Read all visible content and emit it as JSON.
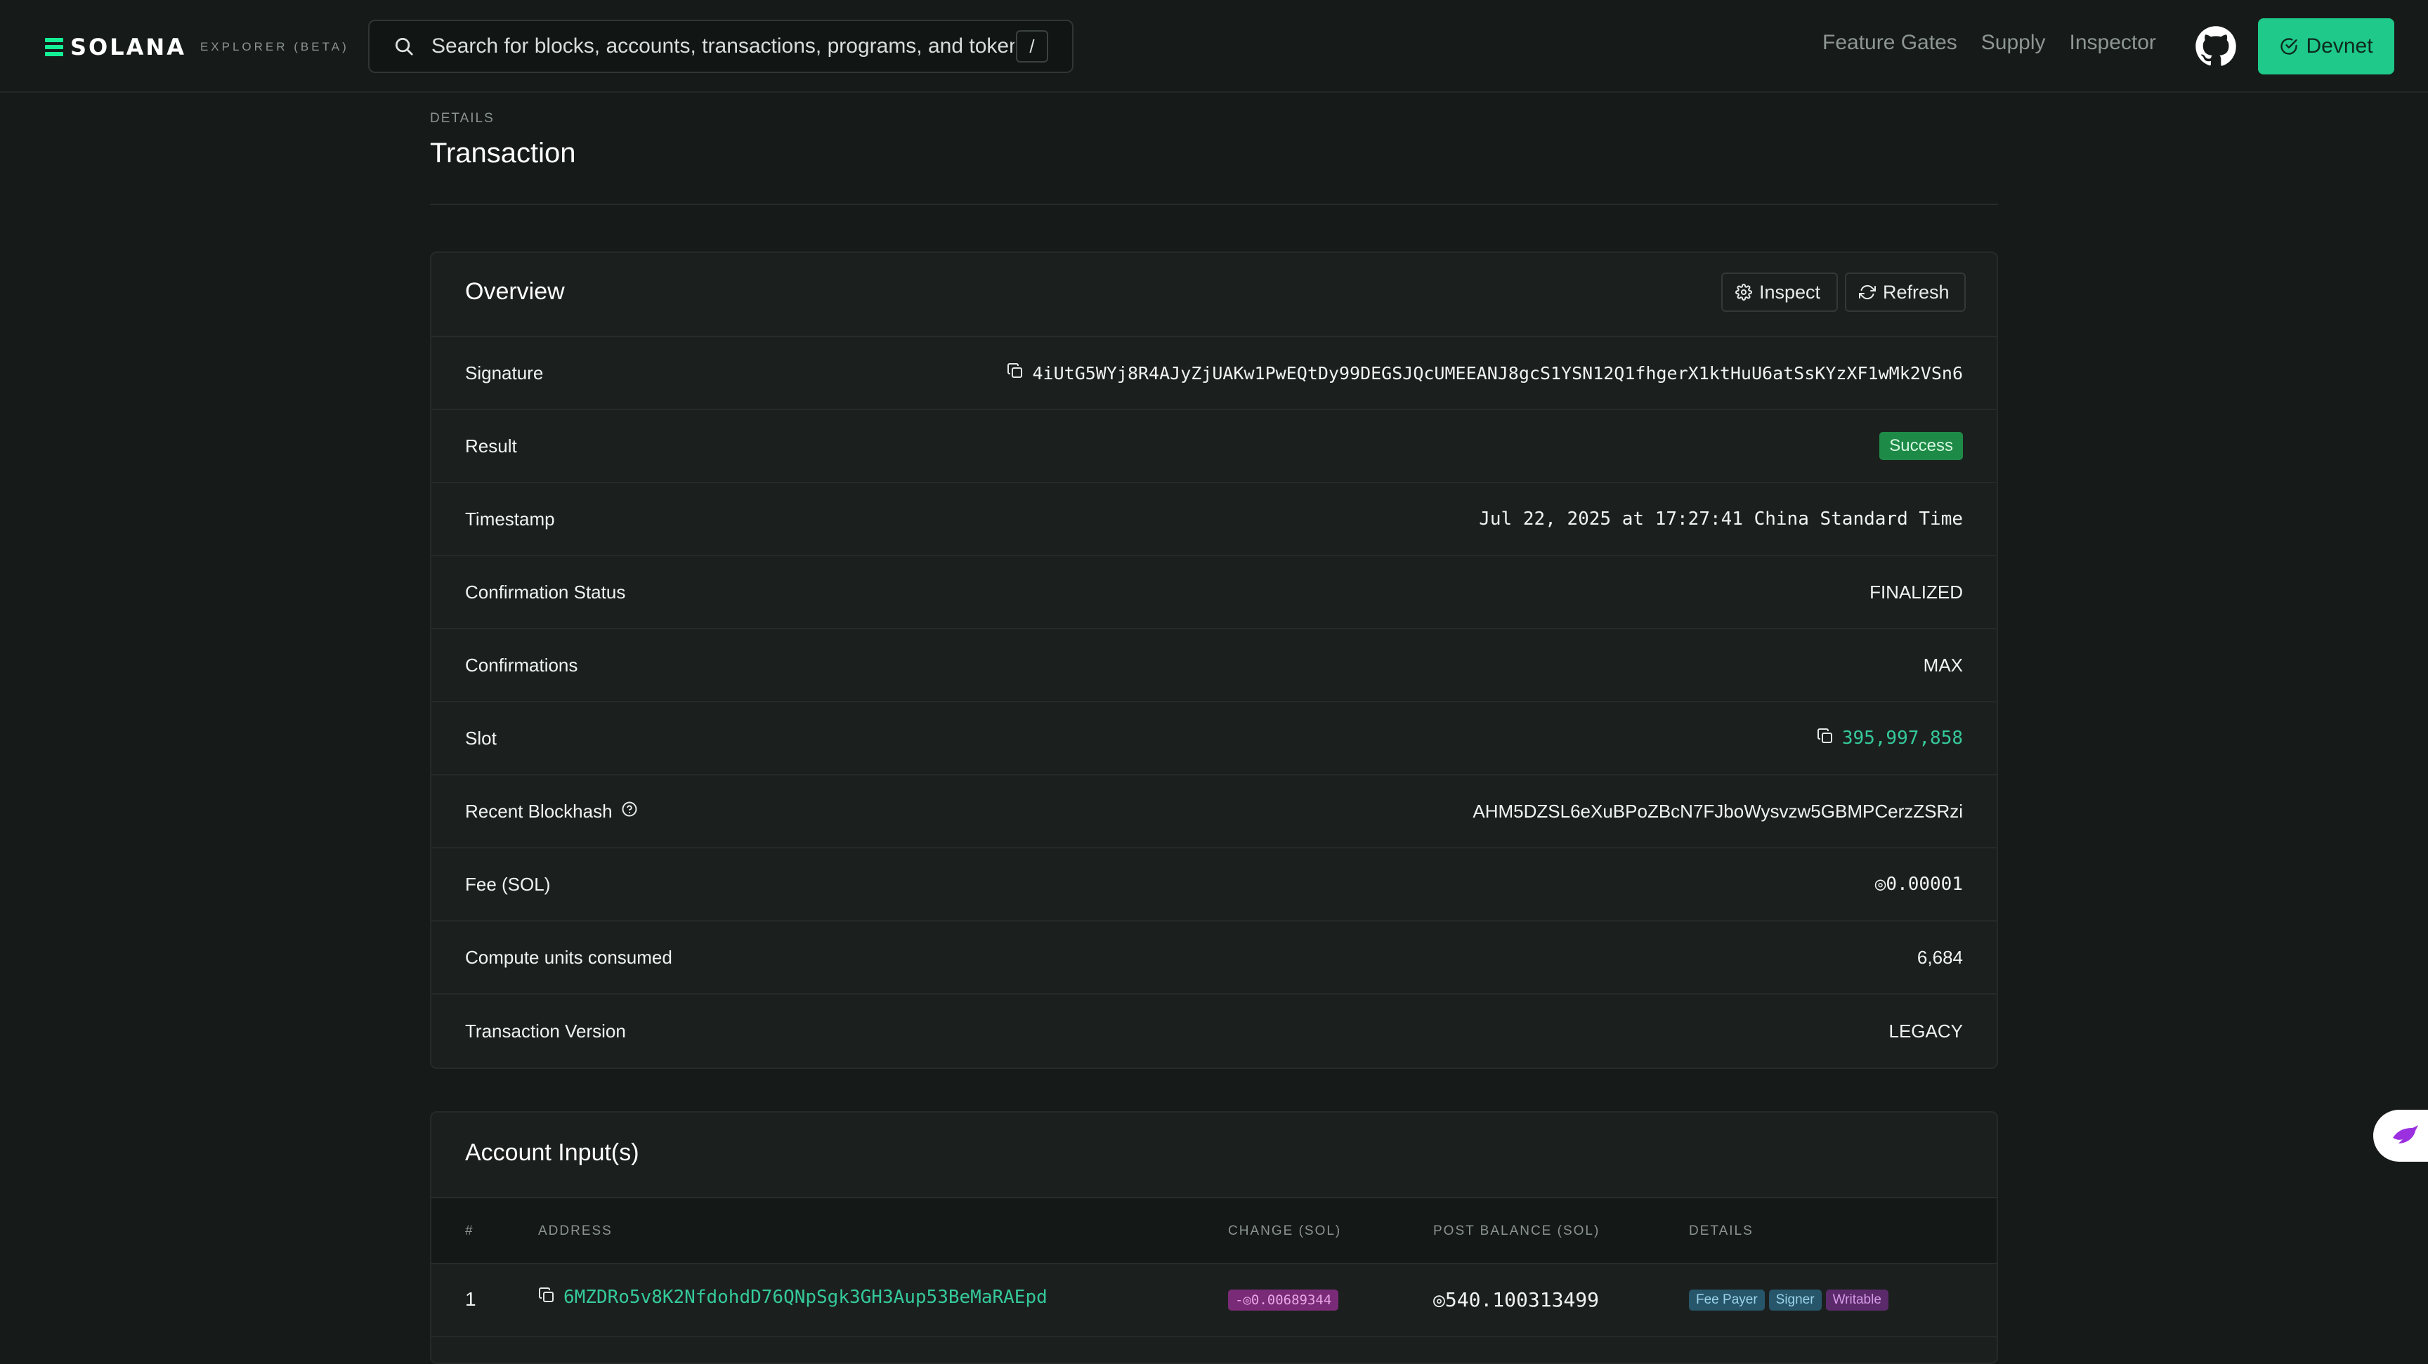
{
  "brand": {
    "name": "SOLANA",
    "subtitle": "EXPLORER (BETA)"
  },
  "search": {
    "placeholder": "Search for blocks, accounts, transactions, programs, and tokens",
    "shortcut": "/"
  },
  "nav": {
    "links": [
      "Feature Gates",
      "Supply",
      "Inspector"
    ],
    "cluster_button": "Devnet"
  },
  "header": {
    "pretitle": "DETAILS",
    "title": "Transaction"
  },
  "overview": {
    "title": "Overview",
    "inspect_label": "Inspect",
    "refresh_label": "Refresh",
    "rows": [
      {
        "label": "Signature",
        "value": "4iUtG5WYj8R4AJyZjUAKw1PwEQtDy99DEGSJQcUMEEANJ8gcS1YSN12Q1fhgerX1ktHuU6atSsKYzXF1wMk2VSn6"
      },
      {
        "label": "Result",
        "value": "Success"
      },
      {
        "label": "Timestamp",
        "value": "Jul 22, 2025 at 17:27:41 China Standard Time"
      },
      {
        "label": "Confirmation Status",
        "value": "FINALIZED"
      },
      {
        "label": "Confirmations",
        "value": "MAX"
      },
      {
        "label": "Slot",
        "value": "395,997,858"
      },
      {
        "label": "Recent Blockhash",
        "value": "AHM5DZSL6eXuBPoZBcN7FJboWysvzw5GBMPCerzZSRzi"
      },
      {
        "label": "Fee (SOL)",
        "value": "◎0.00001"
      },
      {
        "label": "Compute units consumed",
        "value": "6,684"
      },
      {
        "label": "Transaction Version",
        "value": "LEGACY"
      }
    ]
  },
  "accounts": {
    "title": "Account Input(s)",
    "columns": [
      "#",
      "ADDRESS",
      "CHANGE (SOL)",
      "POST BALANCE (SOL)",
      "DETAILS"
    ],
    "rows": [
      {
        "index": "1",
        "address": "6MZDRo5v8K2NfdohdD76QNpSgk3GH3Aup53BeMaRAEpd",
        "change": "-◎0.00689344",
        "post_balance": "◎540.100313499",
        "tags": [
          "Fee Payer",
          "Signer",
          "Writable"
        ]
      }
    ]
  },
  "colors": {
    "accent": "#1ec98a",
    "link": "#35c99a",
    "success": "#1e8a47",
    "background": "#161b19"
  },
  "icons": [
    "search-icon",
    "github-icon",
    "check-circle-icon",
    "gear-icon",
    "refresh-icon",
    "copy-icon",
    "help-circle-icon",
    "bird-icon"
  ]
}
